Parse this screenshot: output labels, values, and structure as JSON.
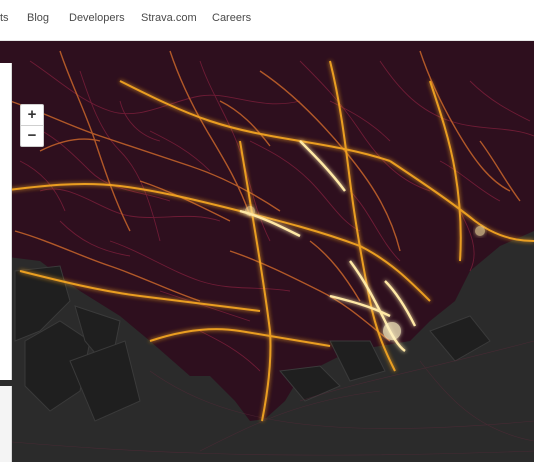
{
  "nav": {
    "items": [
      {
        "label": "ts"
      },
      {
        "label": "Blog"
      },
      {
        "label": "Developers"
      },
      {
        "label": "Strava.com"
      },
      {
        "label": "Careers"
      }
    ]
  },
  "map": {
    "zoom_in": "+",
    "zoom_out": "−",
    "colors": {
      "land": "#2e0f1e",
      "sea": "#2b2b2b",
      "glow": "#ffe9a6",
      "route_hot": "#f5a623",
      "route_mid": "#c0612a",
      "route_cool": "#7a1e3a"
    }
  }
}
